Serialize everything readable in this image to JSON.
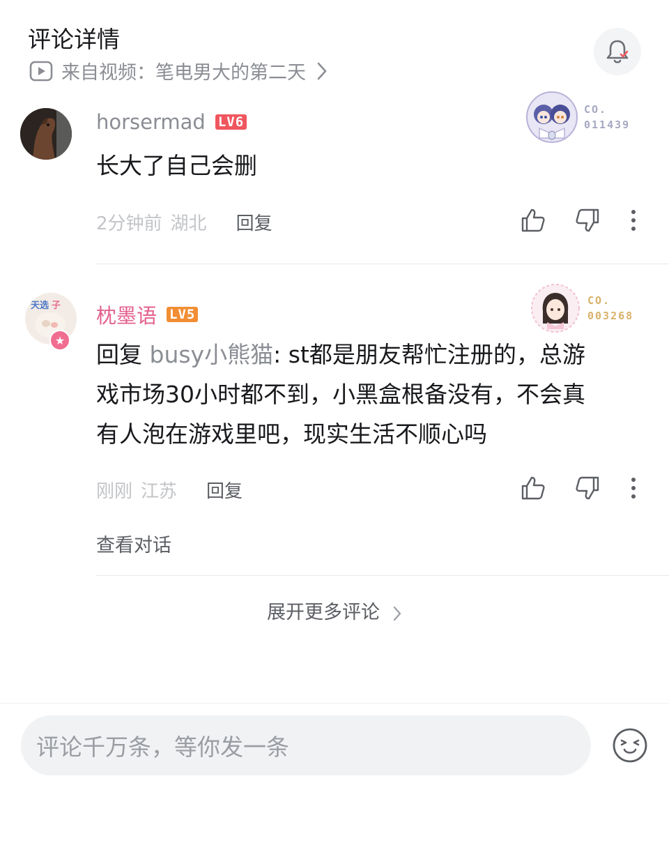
{
  "header": {
    "title": "评论详情",
    "source_text": "来自视频：笔电男大的第二天",
    "notification_icon": "bell-icon"
  },
  "comments": [
    {
      "username": "horsermad",
      "username_color": "#8a8d93",
      "level": "LV6",
      "badge_code_line1": "CO.",
      "badge_code_line2": "011439",
      "badge_color": "#a6a8c2",
      "text": "长大了自己会删",
      "time": "2分钟前",
      "location": "湖北",
      "reply_label": "回复"
    },
    {
      "username": "枕墨语",
      "username_color": "#e4618f",
      "level": "LV5",
      "badge_code_line1": "CO.",
      "badge_code_line2": "003268",
      "badge_color": "#d9b16a",
      "reply_prefix": "回复 ",
      "mention": "busy小熊猫",
      "text_line1": ": st都是朋友帮忙注册的，总游",
      "text_line2": "戏市场30小时都不到，小黑盒根备没有，不会真",
      "text_line3": "有人泡在游戏里吧，现实生活不顺心吗",
      "time": "刚刚",
      "location": "江苏",
      "reply_label": "回复",
      "view_conversation": "查看对话"
    }
  ],
  "expand_more": "展开更多评论",
  "composer": {
    "placeholder": "评论千万条，等你发一条",
    "emoji_icon": "emoji-face-icon"
  }
}
